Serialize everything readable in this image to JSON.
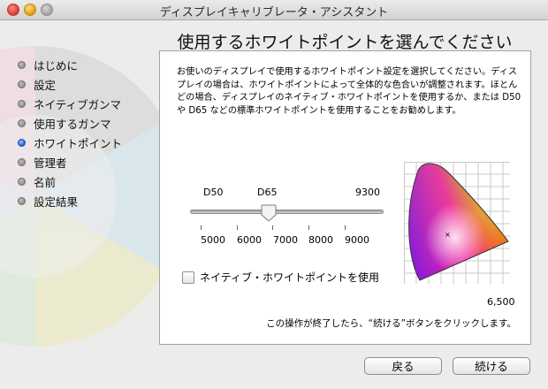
{
  "window": {
    "title": "ディスプレイキャリブレータ・アシスタント"
  },
  "page": {
    "title": "使用するホワイトポイントを選んでください"
  },
  "sidebar": {
    "items": [
      {
        "label": "はじめに"
      },
      {
        "label": "設定"
      },
      {
        "label": "ネイティブガンマ"
      },
      {
        "label": "使用するガンマ"
      },
      {
        "label": "ホワイトポイント",
        "active": true
      },
      {
        "label": "管理者"
      },
      {
        "label": "名前"
      },
      {
        "label": "設定結果"
      }
    ]
  },
  "panel": {
    "description": "お使いのディスプレイで使用するホワイトポイント設定を選択してください。ディスプレイの場合は、ホワイトポイントによって全体的な色合いが調整されます。ほとんどの場合、ディスプレイのネイティブ・ホワイトポイントを使用するか、または D50 や D65 などの標準ホワイトポイントを使用することをお勧めします。",
    "slider": {
      "presets": [
        "D50",
        "D65",
        "9300"
      ],
      "scale_labels": [
        "5000",
        "6000",
        "7000",
        "8000",
        "9000"
      ],
      "value": 6500
    },
    "native_checkbox": {
      "label": "ネイティブ・ホワイトポイントを使用",
      "checked": false
    },
    "white_point_value": "6,500",
    "footer_note": "この操作が終了したら、“続ける”ボタンをクリックします。"
  },
  "buttons": {
    "back": "戻る",
    "continue": "続ける"
  },
  "colors": {
    "accent": "#2f6fd4"
  }
}
